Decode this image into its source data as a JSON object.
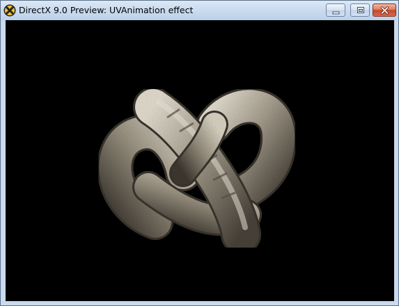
{
  "window": {
    "title": "DirectX 9.0 Preview: UVAnimation effect",
    "icon": "directx-x-icon",
    "controls": {
      "minimize": "minimize-icon",
      "maximize": "maximize-icon",
      "close": "close-icon"
    }
  },
  "viewport": {
    "background": "#000000",
    "object": "textured-torus-knot",
    "object_color": "#b8afa0"
  },
  "colors": {
    "titlebar": "#c8daee",
    "frame": "#c9dbef",
    "close_button": "#d05a3c"
  }
}
